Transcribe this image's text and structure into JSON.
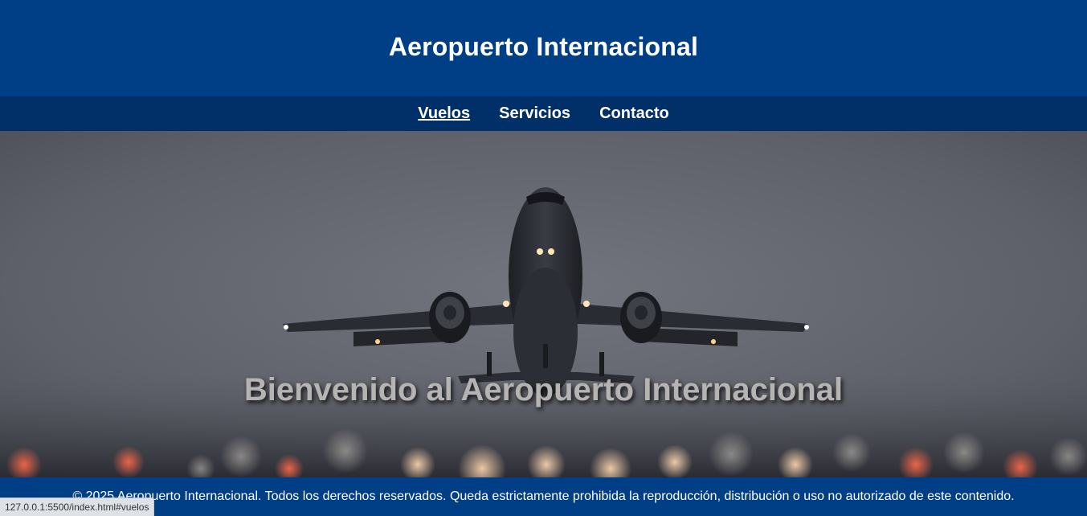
{
  "header": {
    "title": "Aeropuerto Internacional"
  },
  "nav": {
    "items": [
      {
        "label": "Vuelos",
        "href": "#vuelos"
      },
      {
        "label": "Servicios",
        "href": "#servicios"
      },
      {
        "label": "Contacto",
        "href": "#contacto"
      }
    ]
  },
  "hero": {
    "title": "Bienvenido al Aeropuerto Internacional",
    "image": "airplane-takeoff-photo"
  },
  "footer": {
    "text": "© 2025 Aeropuerto Internacional. Todos los derechos reservados. Queda estrictamente prohibida la reproducción, distribución o uso no autorizado de este contenido."
  },
  "status_bar": {
    "url": "127.0.0.1:5500/index.html#vuelos"
  },
  "colors": {
    "header_bg": "#003f86",
    "nav_bg": "#012f68",
    "footer_bg": "#003f86",
    "text": "#ffffff"
  }
}
